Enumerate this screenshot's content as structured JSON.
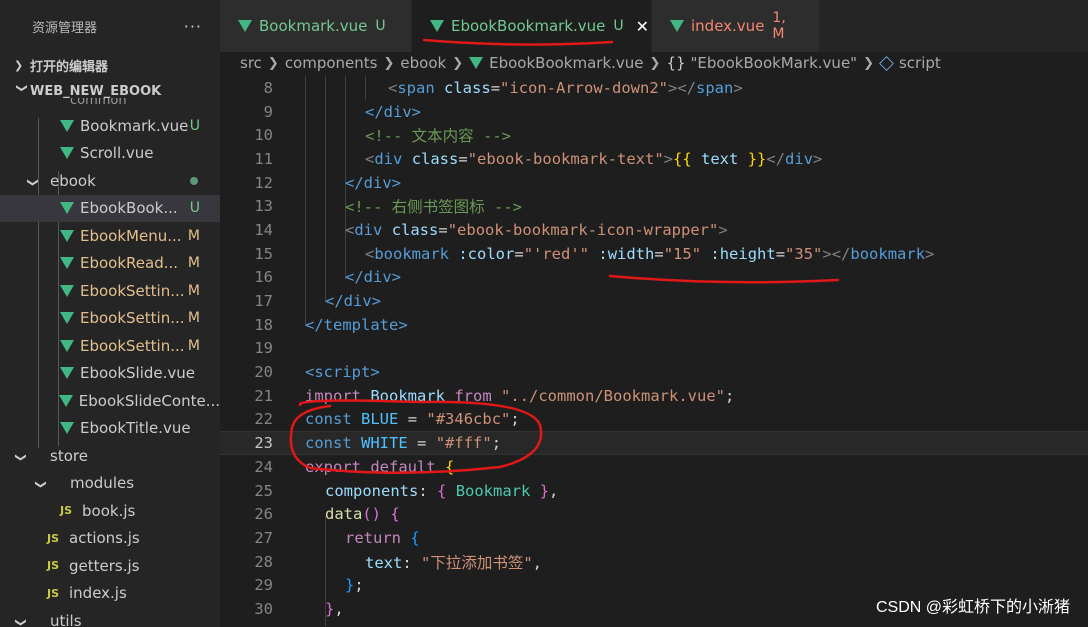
{
  "sidebar": {
    "title": "资源管理器",
    "more": "···",
    "open_editors": "打开的编辑器",
    "project": "WEB_NEW_EBOOK",
    "items": [
      {
        "label": "common",
        "badge": ""
      },
      {
        "label": "Bookmark.vue",
        "badge": "U"
      },
      {
        "label": "Scroll.vue",
        "badge": ""
      },
      {
        "label": "ebook",
        "badge": ""
      },
      {
        "label": "EbookBook...",
        "badge": "U"
      },
      {
        "label": "EbookMenu...",
        "badge": "M"
      },
      {
        "label": "EbookRead...",
        "badge": "M"
      },
      {
        "label": "EbookSettin...",
        "badge": "M"
      },
      {
        "label": "EbookSettin...",
        "badge": "M"
      },
      {
        "label": "EbookSettin...",
        "badge": "M"
      },
      {
        "label": "EbookSlide.vue",
        "badge": ""
      },
      {
        "label": "EbookSlideConte...",
        "badge": ""
      },
      {
        "label": "EbookTitle.vue",
        "badge": ""
      },
      {
        "label": "store",
        "badge": ""
      },
      {
        "label": "modules",
        "badge": ""
      },
      {
        "label": "book.js",
        "badge": ""
      },
      {
        "label": "actions.js",
        "badge": ""
      },
      {
        "label": "getters.js",
        "badge": ""
      },
      {
        "label": "index.js",
        "badge": ""
      },
      {
        "label": "utils",
        "badge": ""
      }
    ],
    "js_label": "JS"
  },
  "tabs": [
    {
      "label": "Bookmark.vue",
      "badge": "U"
    },
    {
      "label": "EbookBookmark.vue",
      "badge": "U",
      "close": "✕"
    },
    {
      "label": "index.vue",
      "badge": "1, M"
    }
  ],
  "breadcrumb": {
    "parts": [
      "src",
      "components",
      "ebook",
      "EbookBookmark.vue",
      "\"EbookBookMark.vue\"",
      "script"
    ],
    "brace": "{}"
  },
  "editor": {
    "line_numbers": [
      "8",
      "9",
      "10",
      "11",
      "12",
      "13",
      "14",
      "15",
      "16",
      "17",
      "18",
      "19",
      "20",
      "21",
      "22",
      "23",
      "24",
      "25",
      "26",
      "27",
      "28",
      "29",
      "30"
    ],
    "tokens": {
      "l8_open": "<",
      "l8_tag": "span",
      "l8_attr": "class",
      "l8_eq": "=",
      "l8_val": "\"icon-Arrow-down2\"",
      "l8_close": "></",
      "l8_tag2": "span",
      "l8_end": ">",
      "l9": "</div>",
      "l10": "<!-- 文本内容 -->",
      "l11_a": "<",
      "l11_tag": "div",
      "l11_attr": "class",
      "l11_val": "\"ebook-bookmark-text\"",
      "l11_b": ">",
      "l11_mus1": "{{",
      "l11_expr": " text ",
      "l11_mus2": "}}",
      "l11_c": "</",
      "l11_tag2": "div",
      "l11_d": ">",
      "l12": "</div>",
      "l13": "<!-- 右侧书签图标 -->",
      "l14_tag": "div",
      "l14_attr": "class",
      "l14_val": "\"ebook-bookmark-icon-wrapper\"",
      "l15_tag": "bookmark",
      "l15_a1": ":color",
      "l15_v1": "\"'red'\"",
      "l15_a2": ":width",
      "l15_v2": "\"15\"",
      "l15_a3": ":height",
      "l15_v3": "\"35\"",
      "l15_tag2": "bookmark",
      "l16": "</div>",
      "l17": "</div>",
      "l18": "</template>",
      "l20": "<script>",
      "l21_import": "import",
      "l21_name": "Bookmark",
      "l21_from": "from",
      "l21_path": "\"../common/Bookmark.vue\"",
      "l22_const": "const",
      "l22_name": "BLUE",
      "l22_val": "\"#346cbc\"",
      "l23_const": "const",
      "l23_name": "WHITE",
      "l23_val": "\"#fff\"",
      "l24_export": "export",
      "l24_default": "default",
      "l25_key": "components",
      "l25_name": "Bookmark",
      "l26_fn": "data",
      "l27_return": "return",
      "l28_key": "text",
      "l28_val": "\"下拉添加书签\""
    }
  },
  "watermark": "CSDN @彩虹桥下的小淅猪",
  "colors": {
    "vue": "#41b883",
    "untracked": "#73c991",
    "modified": "#e2c08d",
    "annotation": "#e01818"
  }
}
